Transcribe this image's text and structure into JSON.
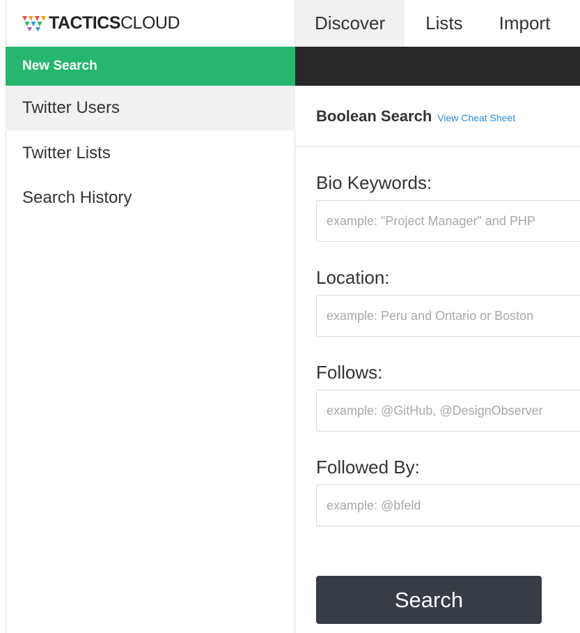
{
  "brand": {
    "bold": "TACTICS",
    "light": "CLOUD",
    "logo_icon": "diamond-triangles-logo-icon"
  },
  "sidebar": {
    "items": [
      {
        "label": "New Search",
        "active": true
      },
      {
        "label": "Twitter Users",
        "active": false
      },
      {
        "label": "Twitter Lists",
        "active": false
      },
      {
        "label": "Search History",
        "active": false
      }
    ]
  },
  "topnav": {
    "tabs": [
      {
        "label": "Discover",
        "active": true
      },
      {
        "label": "Lists",
        "active": false
      },
      {
        "label": "Import",
        "active": false
      }
    ]
  },
  "panel": {
    "title": "Boolean Search",
    "cheat_link": "View Cheat Sheet"
  },
  "form": {
    "bio_keywords": {
      "label": "Bio Keywords:",
      "placeholder": "example: \"Project Manager\" and PHP",
      "value": ""
    },
    "location": {
      "label": "Location:",
      "placeholder": "example: Peru and Ontario or Boston",
      "value": ""
    },
    "follows": {
      "label": "Follows:",
      "placeholder": "example: @GitHub, @DesignObserver",
      "value": ""
    },
    "followed_by": {
      "label": "Followed By:",
      "placeholder": "example: @bfeld",
      "value": ""
    },
    "search_button": "Search"
  },
  "colors": {
    "accent_green": "#27b66d",
    "dark_bar": "#272727",
    "button_dark": "#373c45",
    "link_blue": "#2a8bd9"
  }
}
